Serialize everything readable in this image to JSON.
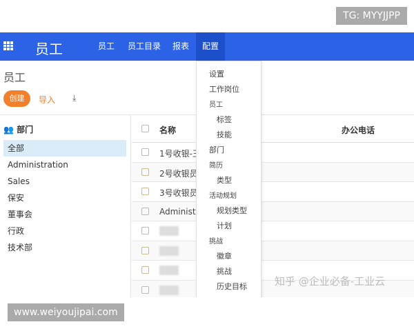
{
  "watermarks": {
    "tg": "TG: MYYJJPP",
    "site": "www.weiyoujipai.com",
    "zhihu": "知乎 @企业必备-工业云"
  },
  "nav": {
    "brand": "员工",
    "items": [
      "员工",
      "员工目录",
      "报表",
      "配置"
    ],
    "active": "配置",
    "color": "#2c63e6"
  },
  "page": {
    "title": "员工",
    "create": "创建",
    "import": "导入",
    "download_icon": "download-icon"
  },
  "sidebar": {
    "header": "部门",
    "items": [
      "全部",
      "Administration",
      "Sales",
      "保安",
      "董事会",
      "行政",
      "技术部"
    ],
    "selected": "全部"
  },
  "table": {
    "columns": [
      "名称",
      "办公电话"
    ],
    "rows": [
      "1号收银-王",
      "2号收银员",
      "3号收银员",
      "Administr",
      "",
      "",
      " ",
      ""
    ]
  },
  "menu": {
    "items": [
      {
        "label": "设置",
        "level": "l1"
      },
      {
        "label": "工作岗位",
        "level": "l1"
      },
      {
        "label": "员工",
        "level": "h"
      },
      {
        "label": "标签",
        "level": "l2"
      },
      {
        "label": "技能",
        "level": "l2"
      },
      {
        "label": "部门",
        "level": "l1"
      },
      {
        "label": "简历",
        "level": "h"
      },
      {
        "label": "类型",
        "level": "l2"
      },
      {
        "label": "活动规划",
        "level": "h"
      },
      {
        "label": "规划类型",
        "level": "l2"
      },
      {
        "label": "计划",
        "level": "l2"
      },
      {
        "label": "挑战",
        "level": "h"
      },
      {
        "label": "徽章",
        "level": "l2"
      },
      {
        "label": "挑战",
        "level": "l2"
      },
      {
        "label": "历史目标",
        "level": "l2"
      }
    ]
  }
}
